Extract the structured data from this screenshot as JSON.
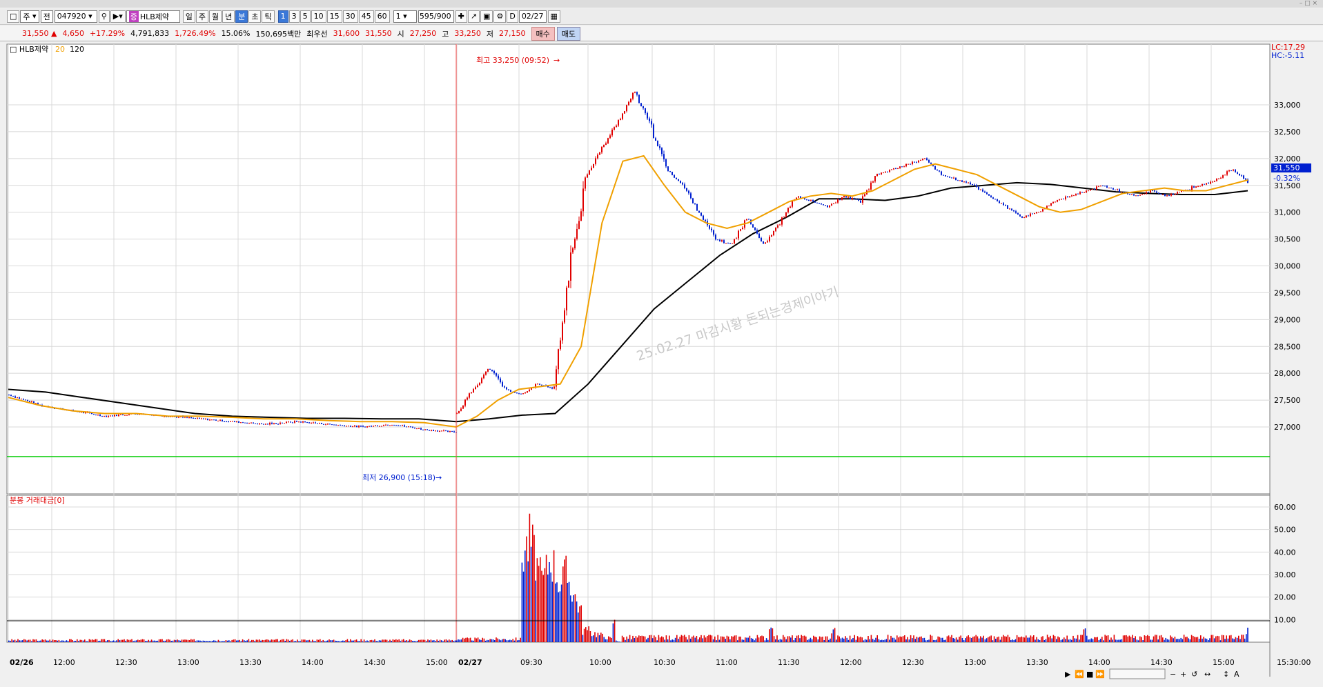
{
  "window": {
    "top_right_text": "– □ ×"
  },
  "toolbar": {
    "market": "주",
    "board": "전",
    "code": "047920",
    "name_badge": "증",
    "name": "HLB제약",
    "periods": [
      "일",
      "주",
      "월",
      "년",
      "분",
      "초",
      "틱"
    ],
    "active_period": "분",
    "intervals": [
      "1",
      "3",
      "5",
      "10",
      "15",
      "30",
      "45",
      "60"
    ],
    "active_interval": "1",
    "count_input": "1",
    "range_text": "595/900",
    "date_label": "D",
    "date": "02/27"
  },
  "quote": {
    "price": "31,550",
    "change_arrow": "▲",
    "change": "4,650",
    "change_pct": "+17.29%",
    "volume": "4,791,833",
    "volume_pct": "1,726.49%",
    "turnover_pct": "15.06%",
    "amount": "150,695백만",
    "best_label": "최우선",
    "best_ask": "31,600",
    "best_bid": "31,550",
    "open_label": "시",
    "open": "27,250",
    "high_label": "고",
    "high": "33,250",
    "low_label": "저",
    "low": "27,150",
    "buy_label": "매수",
    "sell_label": "매도"
  },
  "price_panel": {
    "legend_name": "HLB제약",
    "ma_short": "20",
    "ma_long": "120",
    "lc": "LC:17.29",
    "hc": "HC:-5.11",
    "high_annotation": "최고 33,250 (09:52)",
    "low_annotation": "최저 26,900 (15:18)",
    "current_price_tag": "31,550",
    "current_change_tag": "-0.32%",
    "watermark": "25.02.27 마감시황 돈되는경제이야기",
    "y_ticks": [
      "33,000",
      "32,500",
      "32,000",
      "31,500",
      "31,000",
      "30,500",
      "30,000",
      "29,500",
      "29,000",
      "28,500",
      "28,000",
      "27,500",
      "27,000"
    ]
  },
  "volume_panel": {
    "legend": "분봉 거래대금[0]",
    "y_ticks": [
      "60.00",
      "50.00",
      "40.00",
      "30.00",
      "20.00",
      "10.00"
    ]
  },
  "x_axis": {
    "labels": [
      "02/26",
      "12:00",
      "12:30",
      "13:00",
      "13:30",
      "14:00",
      "14:30",
      "15:00",
      "02/27",
      "09:30",
      "10:00",
      "10:30",
      "11:00",
      "11:30",
      "12:00",
      "12:30",
      "13:00",
      "13:30",
      "14:00",
      "14:30",
      "15:00"
    ],
    "end_label": "15:30:00"
  },
  "colors": {
    "up": "#e00000",
    "down": "#0020d0",
    "ma20": "#f0a000",
    "ma120": "#000000",
    "base_line": "#00cc00",
    "grid": "#d8d8d8"
  },
  "chart_data": {
    "type": "candlestick",
    "ylim": [
      26800,
      33250
    ],
    "high": {
      "value": 33250,
      "time": "09:52"
    },
    "low": {
      "value": 26900,
      "time": "15:18"
    },
    "reference_price": 27250,
    "last": 31550,
    "price_path_day1": [
      27600,
      27400,
      27300,
      27200,
      27250,
      27200,
      27150,
      27100,
      27050,
      27100,
      27050,
      27000,
      27050,
      26950,
      26900
    ],
    "price_path_day2": [
      27250,
      27700,
      28100,
      27700,
      27600,
      27800,
      27700,
      30000,
      31700,
      32200,
      32700,
      33250,
      32600,
      31800,
      31500,
      31000,
      30500,
      30400,
      30900,
      30400,
      30800,
      31300,
      31200,
      31100,
      31300,
      31200,
      31700,
      31800,
      31900,
      32000,
      31700,
      31600,
      31500,
      31300,
      31100,
      30900,
      31000,
      31200,
      31300,
      31400,
      31500,
      31400,
      31300,
      31400,
      31300,
      31400,
      31500,
      31600,
      31800,
      31550
    ],
    "ma20_path_day1": [
      27550,
      27400,
      27300,
      27250,
      27250,
      27200,
      27200,
      27180,
      27150,
      27150,
      27120,
      27100,
      27100,
      27080,
      27000
    ],
    "ma20_path_day2": [
      27000,
      27200,
      27500,
      27700,
      27750,
      27800,
      28500,
      30800,
      31950,
      32050,
      31500,
      31000,
      30800,
      30700,
      30800,
      31000,
      31200,
      31300,
      31350,
      31300,
      31400,
      31600,
      31800,
      31900,
      31800,
      31700,
      31500,
      31300,
      31100,
      31000,
      31050,
      31200,
      31350,
      31400,
      31450,
      31400,
      31400,
      31500,
      31600
    ],
    "ma120_path_day1": [
      27700,
      27650,
      27550,
      27450,
      27350,
      27250,
      27200,
      27180,
      27160,
      27160,
      27150,
      27150,
      27100
    ],
    "ma120_path_day2": [
      27100,
      27150,
      27220,
      27250,
      27800,
      28500,
      29200,
      29700,
      30200,
      30600,
      30900,
      31250,
      31250,
      31220,
      31300,
      31450,
      31500,
      31550,
      31520,
      31450,
      31380,
      31350,
      31330,
      31330,
      31400
    ],
    "volume_peaks": [
      {
        "time": "09:33",
        "value": 57
      },
      {
        "time": "09:35",
        "value": 60
      },
      {
        "time": "09:45",
        "value": 50
      },
      {
        "time": "09:52",
        "value": 40
      },
      {
        "time": "10:15",
        "value": 15
      },
      {
        "time": "11:30",
        "value": 12
      },
      {
        "time": "12:00",
        "value": 10
      },
      {
        "time": "14:00",
        "value": 9
      },
      {
        "time": "15:18",
        "value": 12
      }
    ]
  }
}
